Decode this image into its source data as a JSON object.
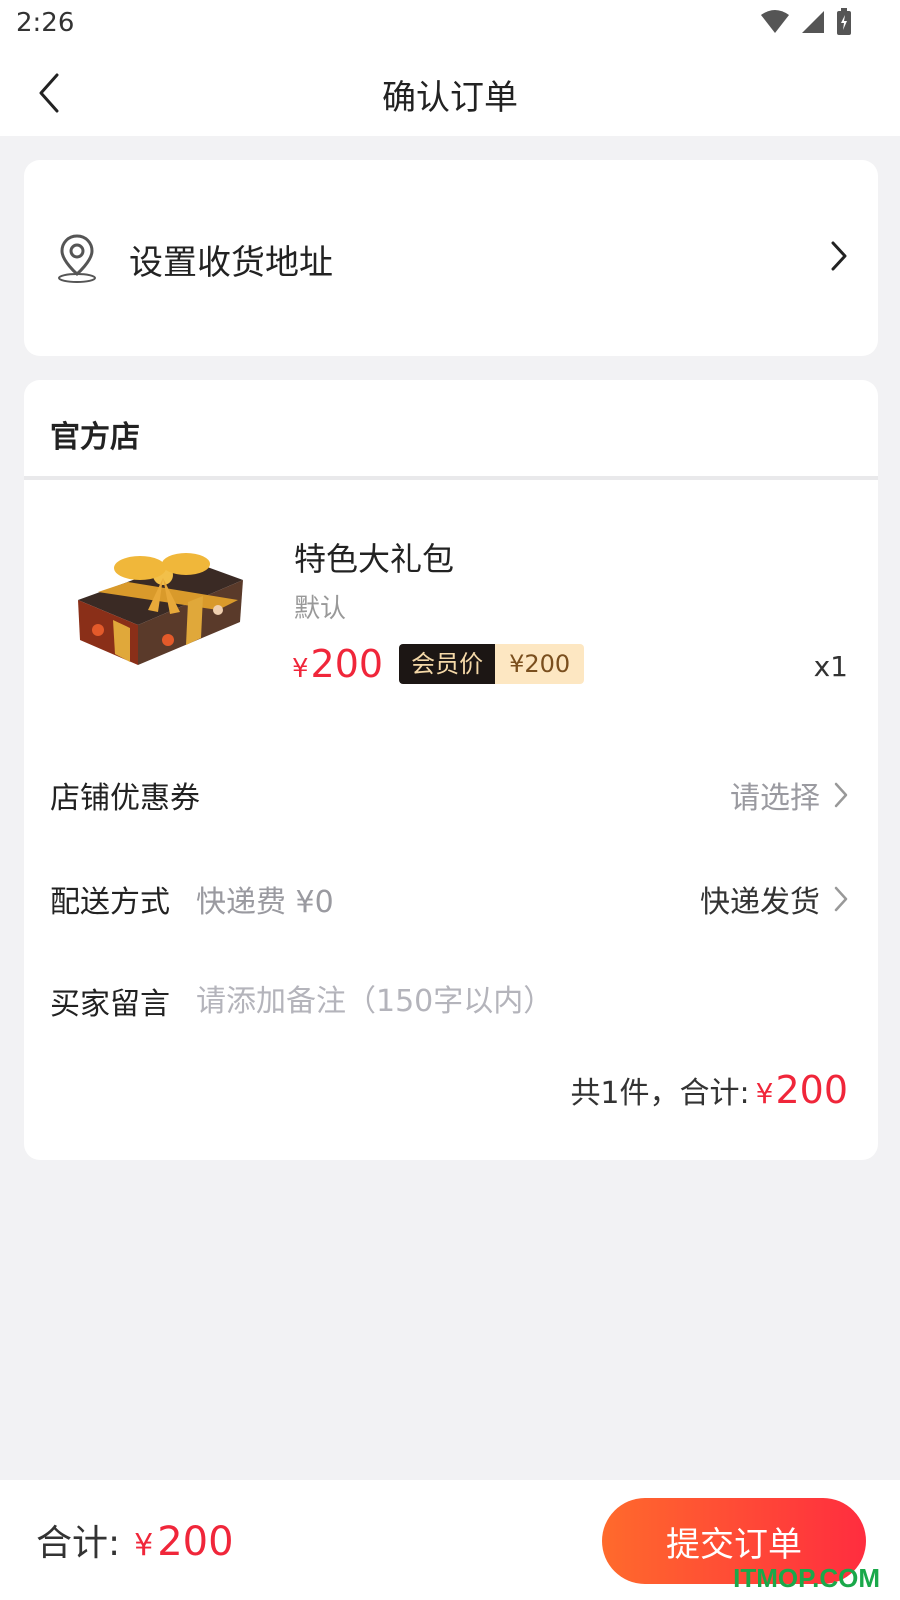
{
  "status_bar": {
    "time": "2:26"
  },
  "header": {
    "title": "确认订单"
  },
  "address": {
    "label": "设置收货地址"
  },
  "shop": {
    "name": "官方店",
    "product": {
      "name": "特色大礼包",
      "spec": "默认",
      "price_currency": "¥",
      "price": "200",
      "member_label": "会员价",
      "member_price": "¥200",
      "quantity": "x1"
    },
    "coupon": {
      "label": "店铺优惠券",
      "value": "请选择"
    },
    "delivery": {
      "label": "配送方式",
      "fee": "快递费 ¥0",
      "method": "快递发货"
    },
    "message": {
      "label": "买家留言",
      "placeholder": "请添加备注（150字以内）",
      "value": ""
    },
    "summary": {
      "text": "共1件，合计:",
      "currency": "¥",
      "total": "200"
    }
  },
  "bottom_bar": {
    "label": "合计:",
    "currency": "¥",
    "total": "200",
    "submit_label": "提交订单",
    "watermark": "ITMOP.COM"
  },
  "colors": {
    "price_red": "#f0263a",
    "button_start": "#ff6a2c",
    "button_end": "#ff2d3f",
    "background": "#f2f2f4"
  }
}
